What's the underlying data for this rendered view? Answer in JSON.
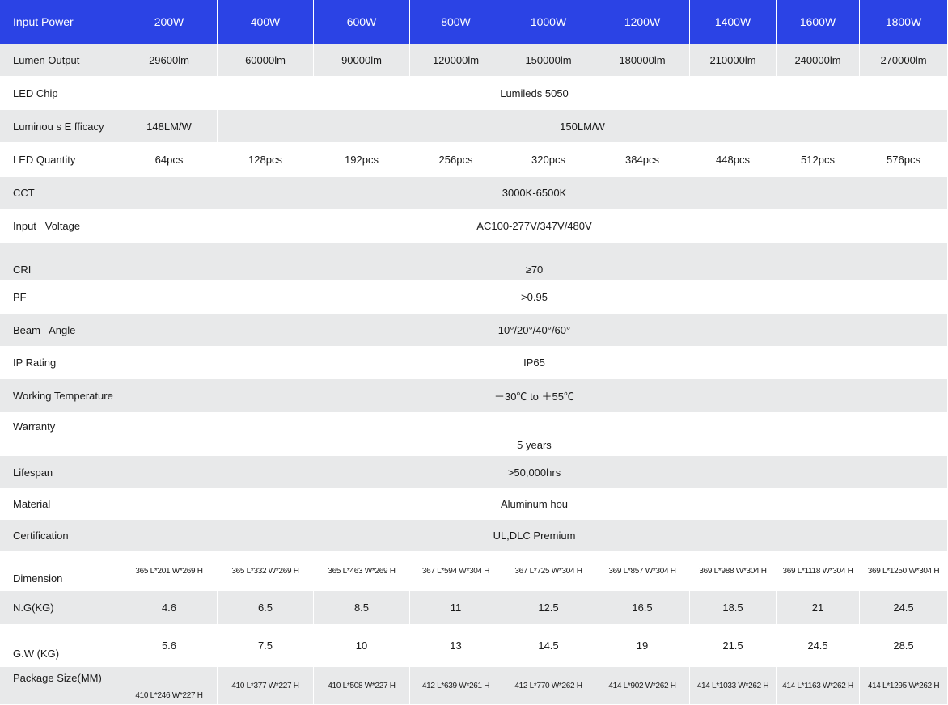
{
  "table": {
    "header": {
      "label": "Input  Power",
      "values": [
        "200W",
        "400W",
        "600W",
        "800W",
        "1000W",
        "1200W",
        "1400W",
        "1600W",
        "1800W"
      ]
    },
    "lumen_output": {
      "label": "Lumen Output",
      "values": [
        "29600lm",
        "60000lm",
        "90000lm",
        "120000lm",
        "150000lm",
        "180000lm",
        "210000lm",
        "240000lm",
        "270000lm"
      ]
    },
    "led_chip": {
      "label": "LED Chip",
      "value": "Lumileds 5050"
    },
    "luminous_efficacy": {
      "label": "Luminou s E fficacy",
      "first": "148LM/W",
      "rest": "150LM/W"
    },
    "led_quantity": {
      "label": "LED Quantity",
      "values": [
        "64pcs",
        "128pcs",
        "192pcs",
        "256pcs",
        "320pcs",
        "384pcs",
        "448pcs",
        "512pcs",
        "576pcs"
      ]
    },
    "cct": {
      "label": "CCT",
      "value": "3000K-6500K"
    },
    "input_voltage": {
      "label": "Input   Voltage",
      "value": "AC100-277V/347V/480V"
    },
    "cri": {
      "label": "CRI",
      "value": "≥70"
    },
    "pf": {
      "label": "PF",
      "value": ">0.95"
    },
    "beam_angle": {
      "label": "Beam   Angle",
      "value": "10°/20°/40°/60°"
    },
    "ip_rating": {
      "label": "IP Rating",
      "value": "IP65"
    },
    "working_temperature": {
      "label": "Working Temperature",
      "value": "－30℃ to ＋55℃"
    },
    "warranty": {
      "label": "Warranty",
      "value": "5 years"
    },
    "lifespan": {
      "label": "Lifespan",
      "value": ">50,000hrs"
    },
    "material": {
      "label": "Material",
      "value": "Aluminum hou"
    },
    "certification": {
      "label": "Certification",
      "value": "UL,DLC Premium"
    },
    "dimension": {
      "label": "Dimension",
      "values": [
        "365 L*201 W*269 H",
        "365 L*332 W*269 H",
        "365 L*463 W*269 H",
        "367 L*594 W*304 H",
        "367 L*725 W*304 H",
        "369 L*857 W*304 H",
        "369 L*988 W*304 H",
        "369 L*1118 W*304 H",
        "369 L*1250 W*304 H"
      ]
    },
    "ng": {
      "label": "N.G(KG)",
      "values": [
        "4.6",
        "6.5",
        "8.5",
        "11",
        "12.5",
        "16.5",
        "18.5",
        "21",
        "24.5"
      ]
    },
    "gw": {
      "label": "G.W (KG)",
      "values": [
        "5.6",
        "7.5",
        "10",
        "13",
        "14.5",
        "19",
        "21.5",
        "24.5",
        "28.5"
      ]
    },
    "package_size": {
      "label": "Package Size(MM)",
      "values": [
        "410 L*246 W*227 H",
        "410 L*377 W*227 H",
        "410 L*508 W*227 H",
        "412 L*639 W*261 H",
        "412 L*770 W*262 H",
        "414 L*902 W*262 H",
        "414 L*1033 W*262 H",
        "414 L*1163 W*262 H",
        "414 L*1295 W*262 H"
      ]
    }
  }
}
